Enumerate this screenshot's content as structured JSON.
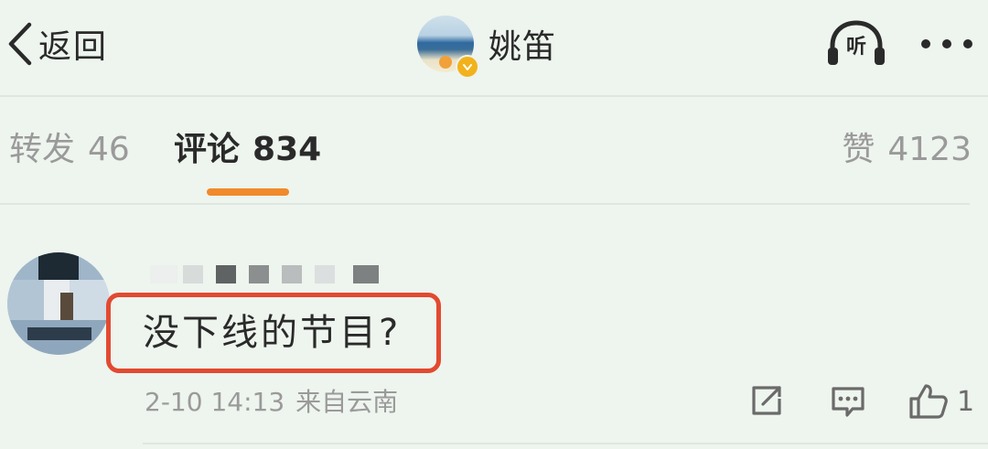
{
  "header": {
    "back_label": "返回",
    "profile_name": "姚笛",
    "listen_label": "听",
    "avatar": "profile-avatar",
    "verified_icon": "verified-badge-icon",
    "more_icon": "more-dots-icon"
  },
  "tabs": {
    "reposts": {
      "label": "转发",
      "count": "46"
    },
    "comments": {
      "label": "评论",
      "count": "834"
    },
    "likes": {
      "label": "赞",
      "count": "4123"
    },
    "active": "comments",
    "indicator_color": "#f08a2c"
  },
  "comment": {
    "username_blurred": true,
    "avatar_blurred": true,
    "text": "没下线的节目?",
    "timestamp": "2-10 14:13",
    "location": "来自云南",
    "like_count": "1",
    "highlight_color": "#e24a30",
    "actions": [
      "share-icon",
      "reply-icon",
      "like-icon"
    ]
  },
  "colors": {
    "background": "#eef4ee",
    "text_primary": "#2a2a2a",
    "text_secondary": "#9a9a9a"
  }
}
